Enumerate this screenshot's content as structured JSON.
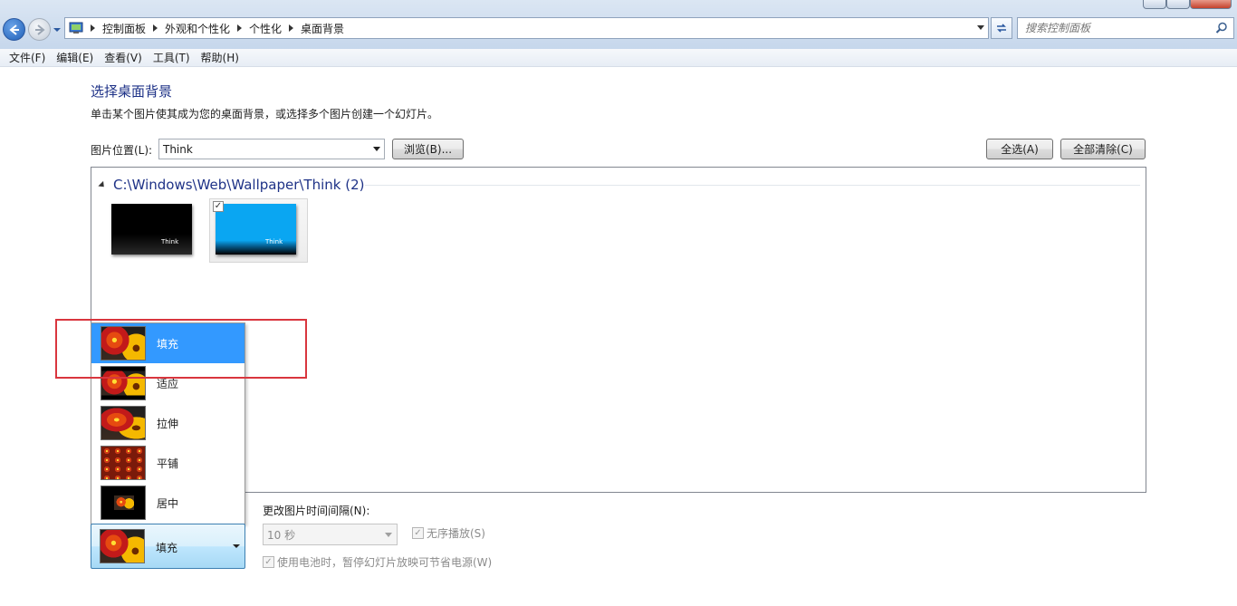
{
  "address": {
    "crumbs": [
      "控制面板",
      "外观和个性化",
      "个性化",
      "桌面背景"
    ]
  },
  "search": {
    "placeholder": "搜索控制面板"
  },
  "menu": [
    "文件(F)",
    "编辑(E)",
    "查看(V)",
    "工具(T)",
    "帮助(H)"
  ],
  "page": {
    "title": "选择桌面背景",
    "subtitle": "单击某个图片使其成为您的桌面背景，或选择多个图片创建一个幻灯片。",
    "location_label": "图片位置(L):",
    "location_value": "Think",
    "browse_label": "浏览(B)...",
    "select_all_label": "全选(A)",
    "clear_all_label": "全部清除(C)"
  },
  "gallery": {
    "group_header": "C:\\Windows\\Web\\Wallpaper\\Think (2)",
    "thumbs": [
      {
        "label": "Think",
        "selected": false
      },
      {
        "label": "Think",
        "selected": true
      }
    ],
    "check_mark": "✓"
  },
  "position": {
    "options": [
      "填充",
      "适应",
      "拉伸",
      "平铺",
      "居中"
    ],
    "selected": "填充"
  },
  "slideshow": {
    "interval_label": "更改图片时间间隔(N):",
    "interval_value": "10 秒",
    "shuffle_label": "无序播放(S)",
    "battery_label": "使用电池时，暂停幻灯片放映可节省电源(W)",
    "check_mark": "✓"
  },
  "colors": {
    "title": "#1e3287",
    "highlight": "#3399ff",
    "annotation": "#d9363e"
  }
}
